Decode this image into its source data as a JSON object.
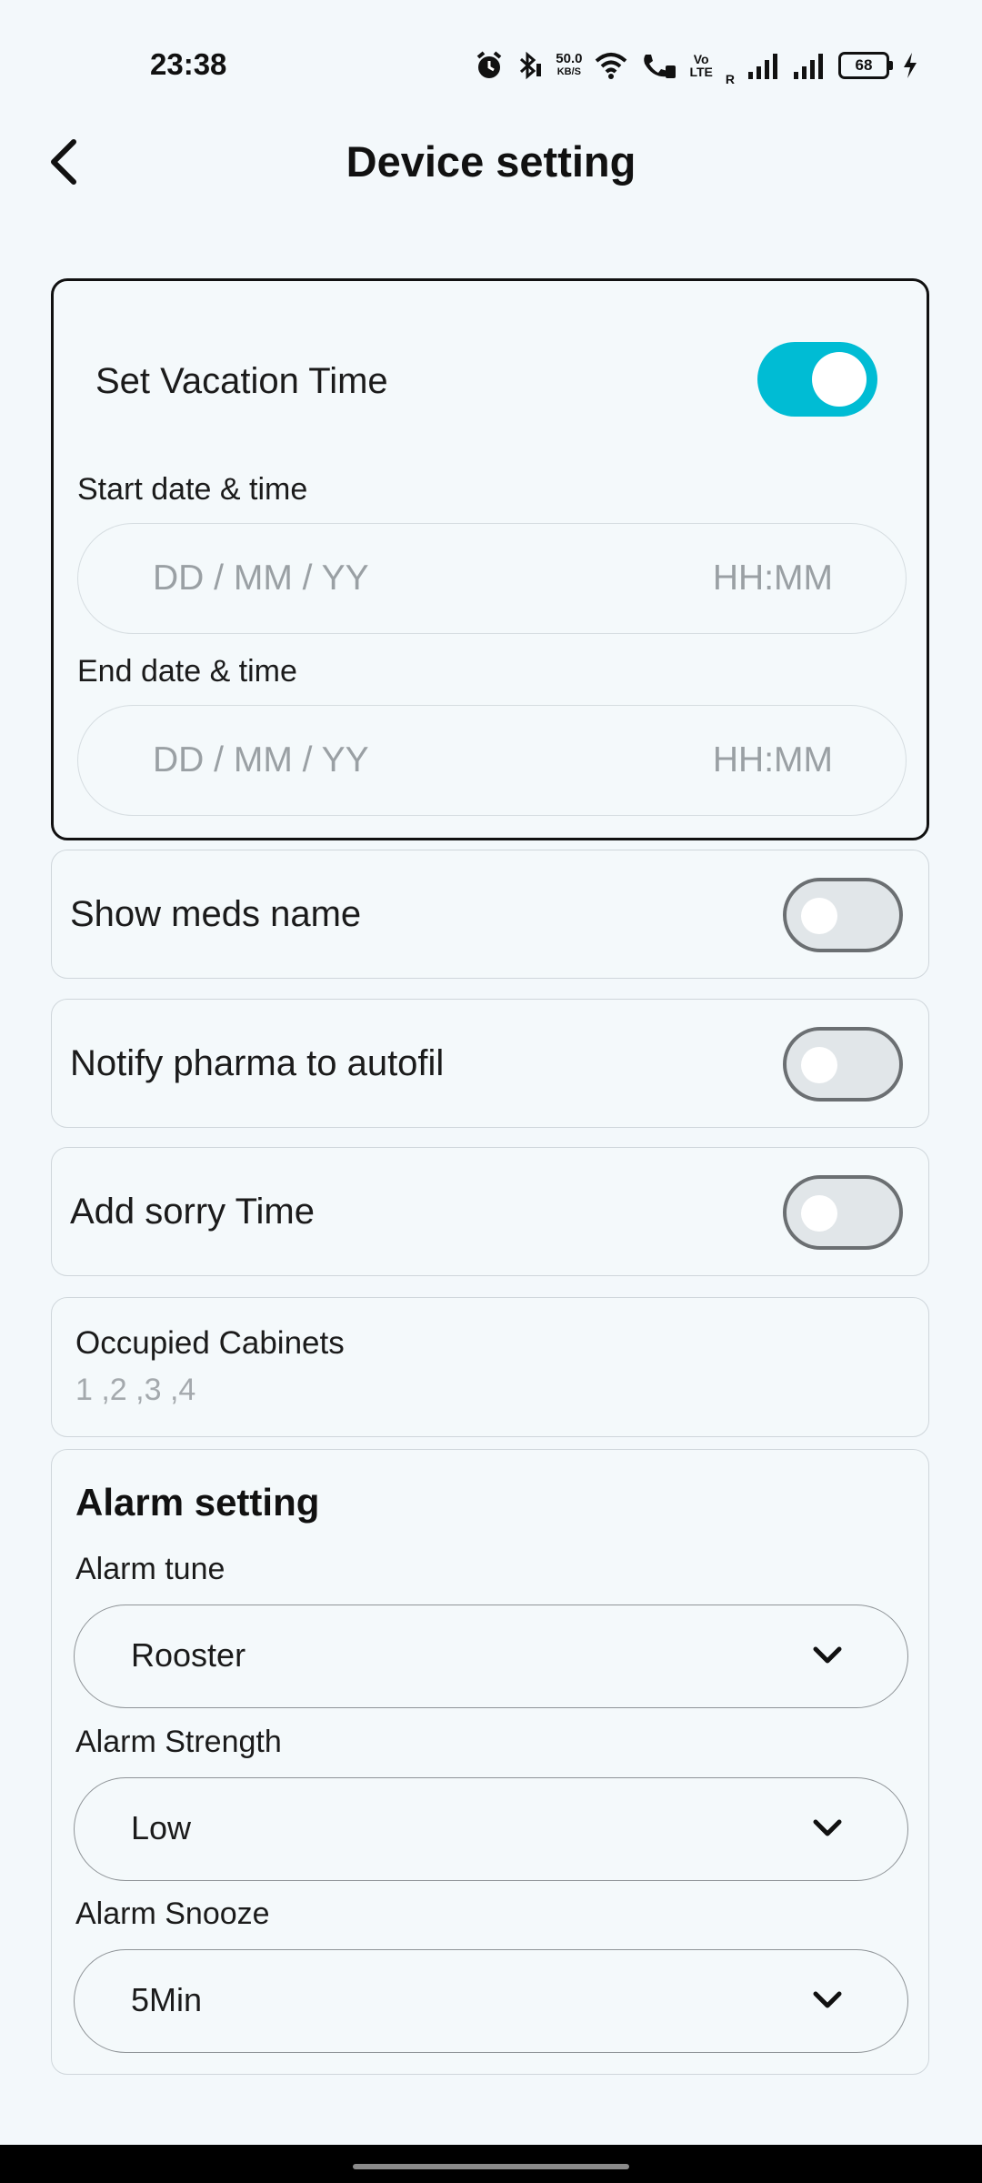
{
  "status_bar": {
    "time": "23:38",
    "net_speed_value": "50.0",
    "net_speed_unit": "KB/S",
    "volte_top": "Vo",
    "volte_bottom": "LTE",
    "roaming": "R",
    "battery": "68",
    "icons": [
      "alarm-icon",
      "bluetooth-icon",
      "wifi-icon",
      "wifi-call-icon",
      "signal-icon",
      "signal-icon",
      "charging-icon"
    ]
  },
  "header": {
    "title": "Device setting",
    "back_icon": "chevron-left-icon"
  },
  "vacation": {
    "label": "Set Vacation Time",
    "enabled": true,
    "start_label": "Start date & time",
    "start_date_placeholder": "DD / MM / YY",
    "start_time_placeholder": "HH:MM",
    "end_label": "End date & time",
    "end_date_placeholder": "DD / MM / YY",
    "end_time_placeholder": "HH:MM"
  },
  "toggles": [
    {
      "label": "Show meds name",
      "enabled": false
    },
    {
      "label": "Notify pharma to autofil",
      "enabled": false
    },
    {
      "label": "Add sorry Time",
      "enabled": false
    }
  ],
  "cabinets": {
    "label": "Occupied Cabinets",
    "value": "1 ,2 ,3 ,4"
  },
  "alarm": {
    "title": "Alarm setting",
    "tune_label": "Alarm tune",
    "tune_value": "Rooster",
    "strength_label": "Alarm Strength",
    "strength_value": "Low",
    "snooze_label": "Alarm Snooze",
    "snooze_value": "5Min"
  },
  "colors": {
    "accent": "#00bcd4",
    "background": "#f3f8fb",
    "placeholder": "#9aa0a4"
  }
}
